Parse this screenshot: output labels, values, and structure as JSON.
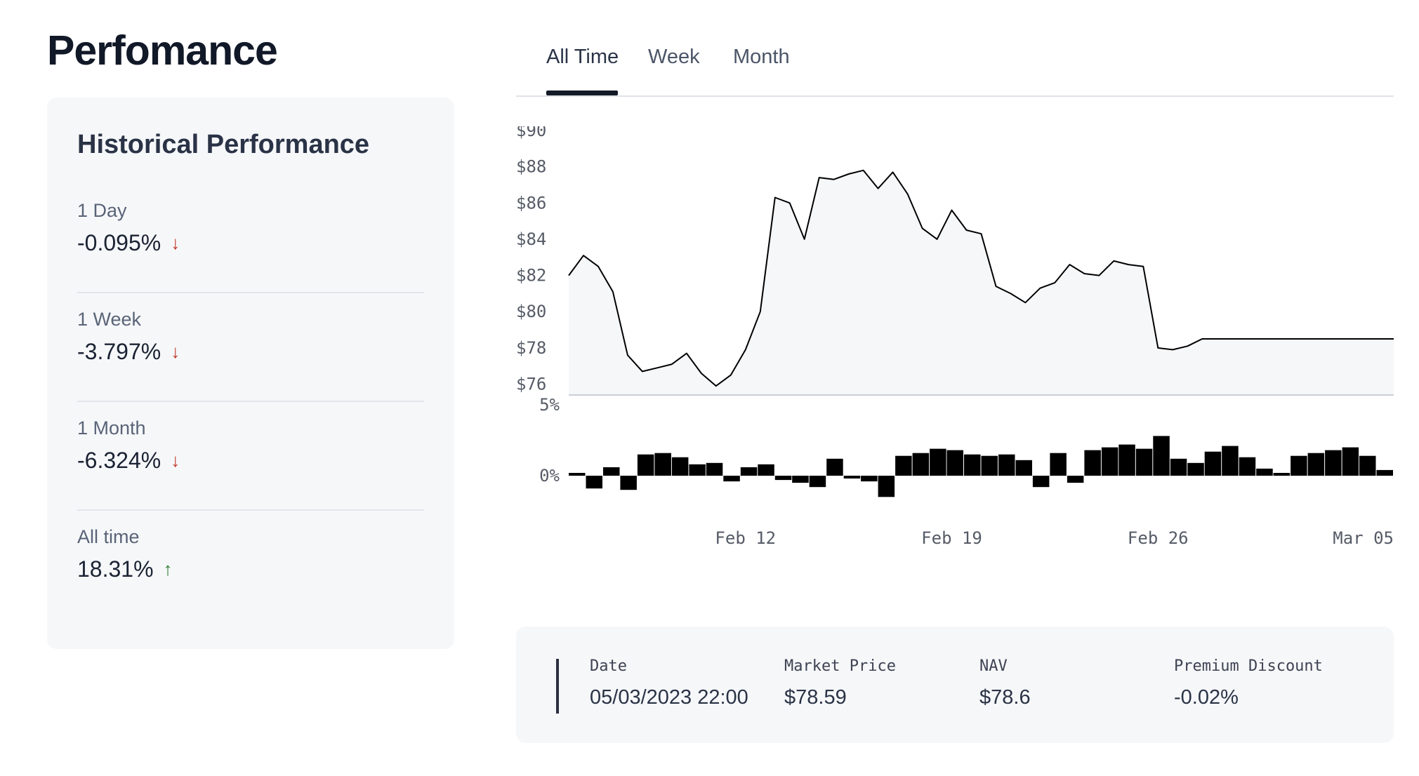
{
  "page": {
    "title": "Perfomance"
  },
  "historical": {
    "title": "Historical Performance",
    "stats": [
      {
        "label": "1 Day",
        "value": "-0.095%",
        "direction": "down",
        "arrow": "↓"
      },
      {
        "label": "1 Week",
        "value": "-3.797%",
        "direction": "down",
        "arrow": "↓"
      },
      {
        "label": "1 Month",
        "value": "-6.324%",
        "direction": "down",
        "arrow": "↓"
      },
      {
        "label": "All time",
        "value": "18.31%",
        "direction": "up",
        "arrow": "↑"
      }
    ]
  },
  "tabs": [
    {
      "label": "All Time",
      "active": true
    },
    {
      "label": "Week",
      "active": false
    },
    {
      "label": "Month",
      "active": false
    }
  ],
  "colors": {
    "down": "#c0392b",
    "up": "#2e7d32",
    "line": "#000000",
    "area": "#f6f7f9"
  },
  "chart_data": {
    "type": "line",
    "title": "",
    "price": {
      "y_ticks": [
        "$76",
        "$78",
        "$80",
        "$82",
        "$84",
        "$86",
        "$88",
        "$90"
      ],
      "ylim": [
        75.4,
        90
      ],
      "x": [
        "2023-02-06",
        "2023-02-06 12:00",
        "2023-02-07",
        "2023-02-07 12:00",
        "2023-02-08",
        "2023-02-08 12:00",
        "2023-02-09",
        "2023-02-09 12:00",
        "2023-02-10",
        "2023-02-10 12:00",
        "2023-02-11",
        "2023-02-11 12:00",
        "2023-02-12",
        "2023-02-12 12:00",
        "2023-02-13",
        "2023-02-13 12:00",
        "2023-02-14",
        "2023-02-14 12:00",
        "2023-02-15",
        "2023-02-15 12:00",
        "2023-02-16",
        "2023-02-16 12:00",
        "2023-02-17",
        "2023-02-17 12:00",
        "2023-02-18",
        "2023-02-18 12:00",
        "2023-02-19",
        "2023-02-19 12:00",
        "2023-02-20",
        "2023-02-20 12:00",
        "2023-02-21",
        "2023-02-21 12:00",
        "2023-02-22",
        "2023-02-22 12:00",
        "2023-02-23",
        "2023-02-23 12:00",
        "2023-02-24",
        "2023-02-24 12:00",
        "2023-02-25",
        "2023-02-25 12:00",
        "2023-02-26",
        "2023-02-26 12:00",
        "2023-02-27",
        "2023-02-27 12:00",
        "2023-02-28",
        "2023-02-28 12:00",
        "2023-03-01",
        "2023-03-01 12:00",
        "2023-03-02",
        "2023-03-02 12:00",
        "2023-03-03",
        "2023-03-03 12:00",
        "2023-03-04",
        "2023-03-04 12:00",
        "2023-03-05",
        "2023-03-05 12:00"
      ],
      "values": [
        82.0,
        83.1,
        82.5,
        81.1,
        77.6,
        76.7,
        76.9,
        77.1,
        77.7,
        76.6,
        75.9,
        76.5,
        77.9,
        80.0,
        86.3,
        86.0,
        84.0,
        87.4,
        87.3,
        87.6,
        87.8,
        86.8,
        87.7,
        86.5,
        84.6,
        84.0,
        85.6,
        84.5,
        84.3,
        81.4,
        81.0,
        80.5,
        81.3,
        81.6,
        82.6,
        82.1,
        82.0,
        82.8,
        82.6,
        82.5,
        78.0,
        77.9,
        78.1,
        78.5
      ]
    },
    "premium": {
      "y_ticks": [
        "5%",
        "0%"
      ],
      "ylim": [
        -2.4,
        5
      ],
      "values": [
        0.2,
        -0.9,
        0.6,
        -1.0,
        1.5,
        1.6,
        1.3,
        0.8,
        0.9,
        -0.4,
        0.6,
        0.8,
        -0.3,
        -0.5,
        -0.8,
        1.2,
        -0.2,
        -0.4,
        -1.5,
        1.4,
        1.6,
        1.9,
        1.8,
        1.5,
        1.4,
        1.5,
        1.1,
        -0.8,
        1.6,
        -0.5,
        1.8,
        2.0,
        2.2,
        1.9,
        2.8,
        1.2,
        0.9,
        1.7,
        2.1,
        1.3,
        0.5,
        0.2,
        1.4,
        1.6,
        1.8,
        2.0,
        1.4,
        0.4
      ]
    },
    "x_ticks": [
      "Feb 12",
      "Feb 19",
      "Feb 26",
      "Mar 05"
    ],
    "xlabel": "",
    "ylabel": "",
    "grid": false
  },
  "info": {
    "columns": [
      {
        "heading": "Date",
        "value": "05/03/2023 22:00"
      },
      {
        "heading": "Market Price",
        "value": "$78.59"
      },
      {
        "heading": "NAV",
        "value": "$78.6"
      },
      {
        "heading": "Premium Discount",
        "value": "-0.02%"
      }
    ]
  }
}
